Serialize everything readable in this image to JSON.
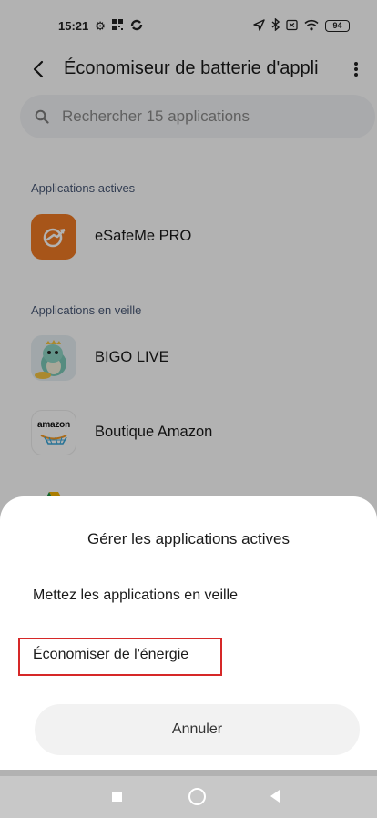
{
  "status_bar": {
    "time": "15:21",
    "icons_left": [
      "gear-icon",
      "grid-icon",
      "sync-icon"
    ],
    "icons_right": [
      "location-icon",
      "bluetooth-icon",
      "sim-off-icon",
      "wifi-icon"
    ],
    "battery_level": "94"
  },
  "app_bar": {
    "title": "Économiseur de batterie d'appli"
  },
  "search": {
    "placeholder": "Rechercher 15 applications"
  },
  "sections": [
    {
      "header": "Applications actives",
      "apps": [
        {
          "name": "eSafeMe PRO",
          "icon": "esafeme-app-icon"
        }
      ]
    },
    {
      "header": "Applications en veille",
      "apps": [
        {
          "name": "BIGO LIVE",
          "icon": "bigo-live-app-icon"
        },
        {
          "name": "Boutique Amazon",
          "icon": "amazon-app-icon",
          "icon_text": "amazon"
        }
      ]
    }
  ],
  "sheet": {
    "title": "Gérer les applications actives",
    "options": [
      "Mettez les applications en veille",
      "Économiser de l'énergie"
    ],
    "cancel_label": "Annuler"
  },
  "colors": {
    "accent_highlight": "#d62828",
    "esafeme_orange": "#ef7a24",
    "section_header": "#4a5a78",
    "overlay": "rgba(0,0,0,0.30)"
  },
  "nav_bar": {
    "icons": [
      "recent-apps-icon",
      "home-icon",
      "back-nav-icon"
    ]
  }
}
